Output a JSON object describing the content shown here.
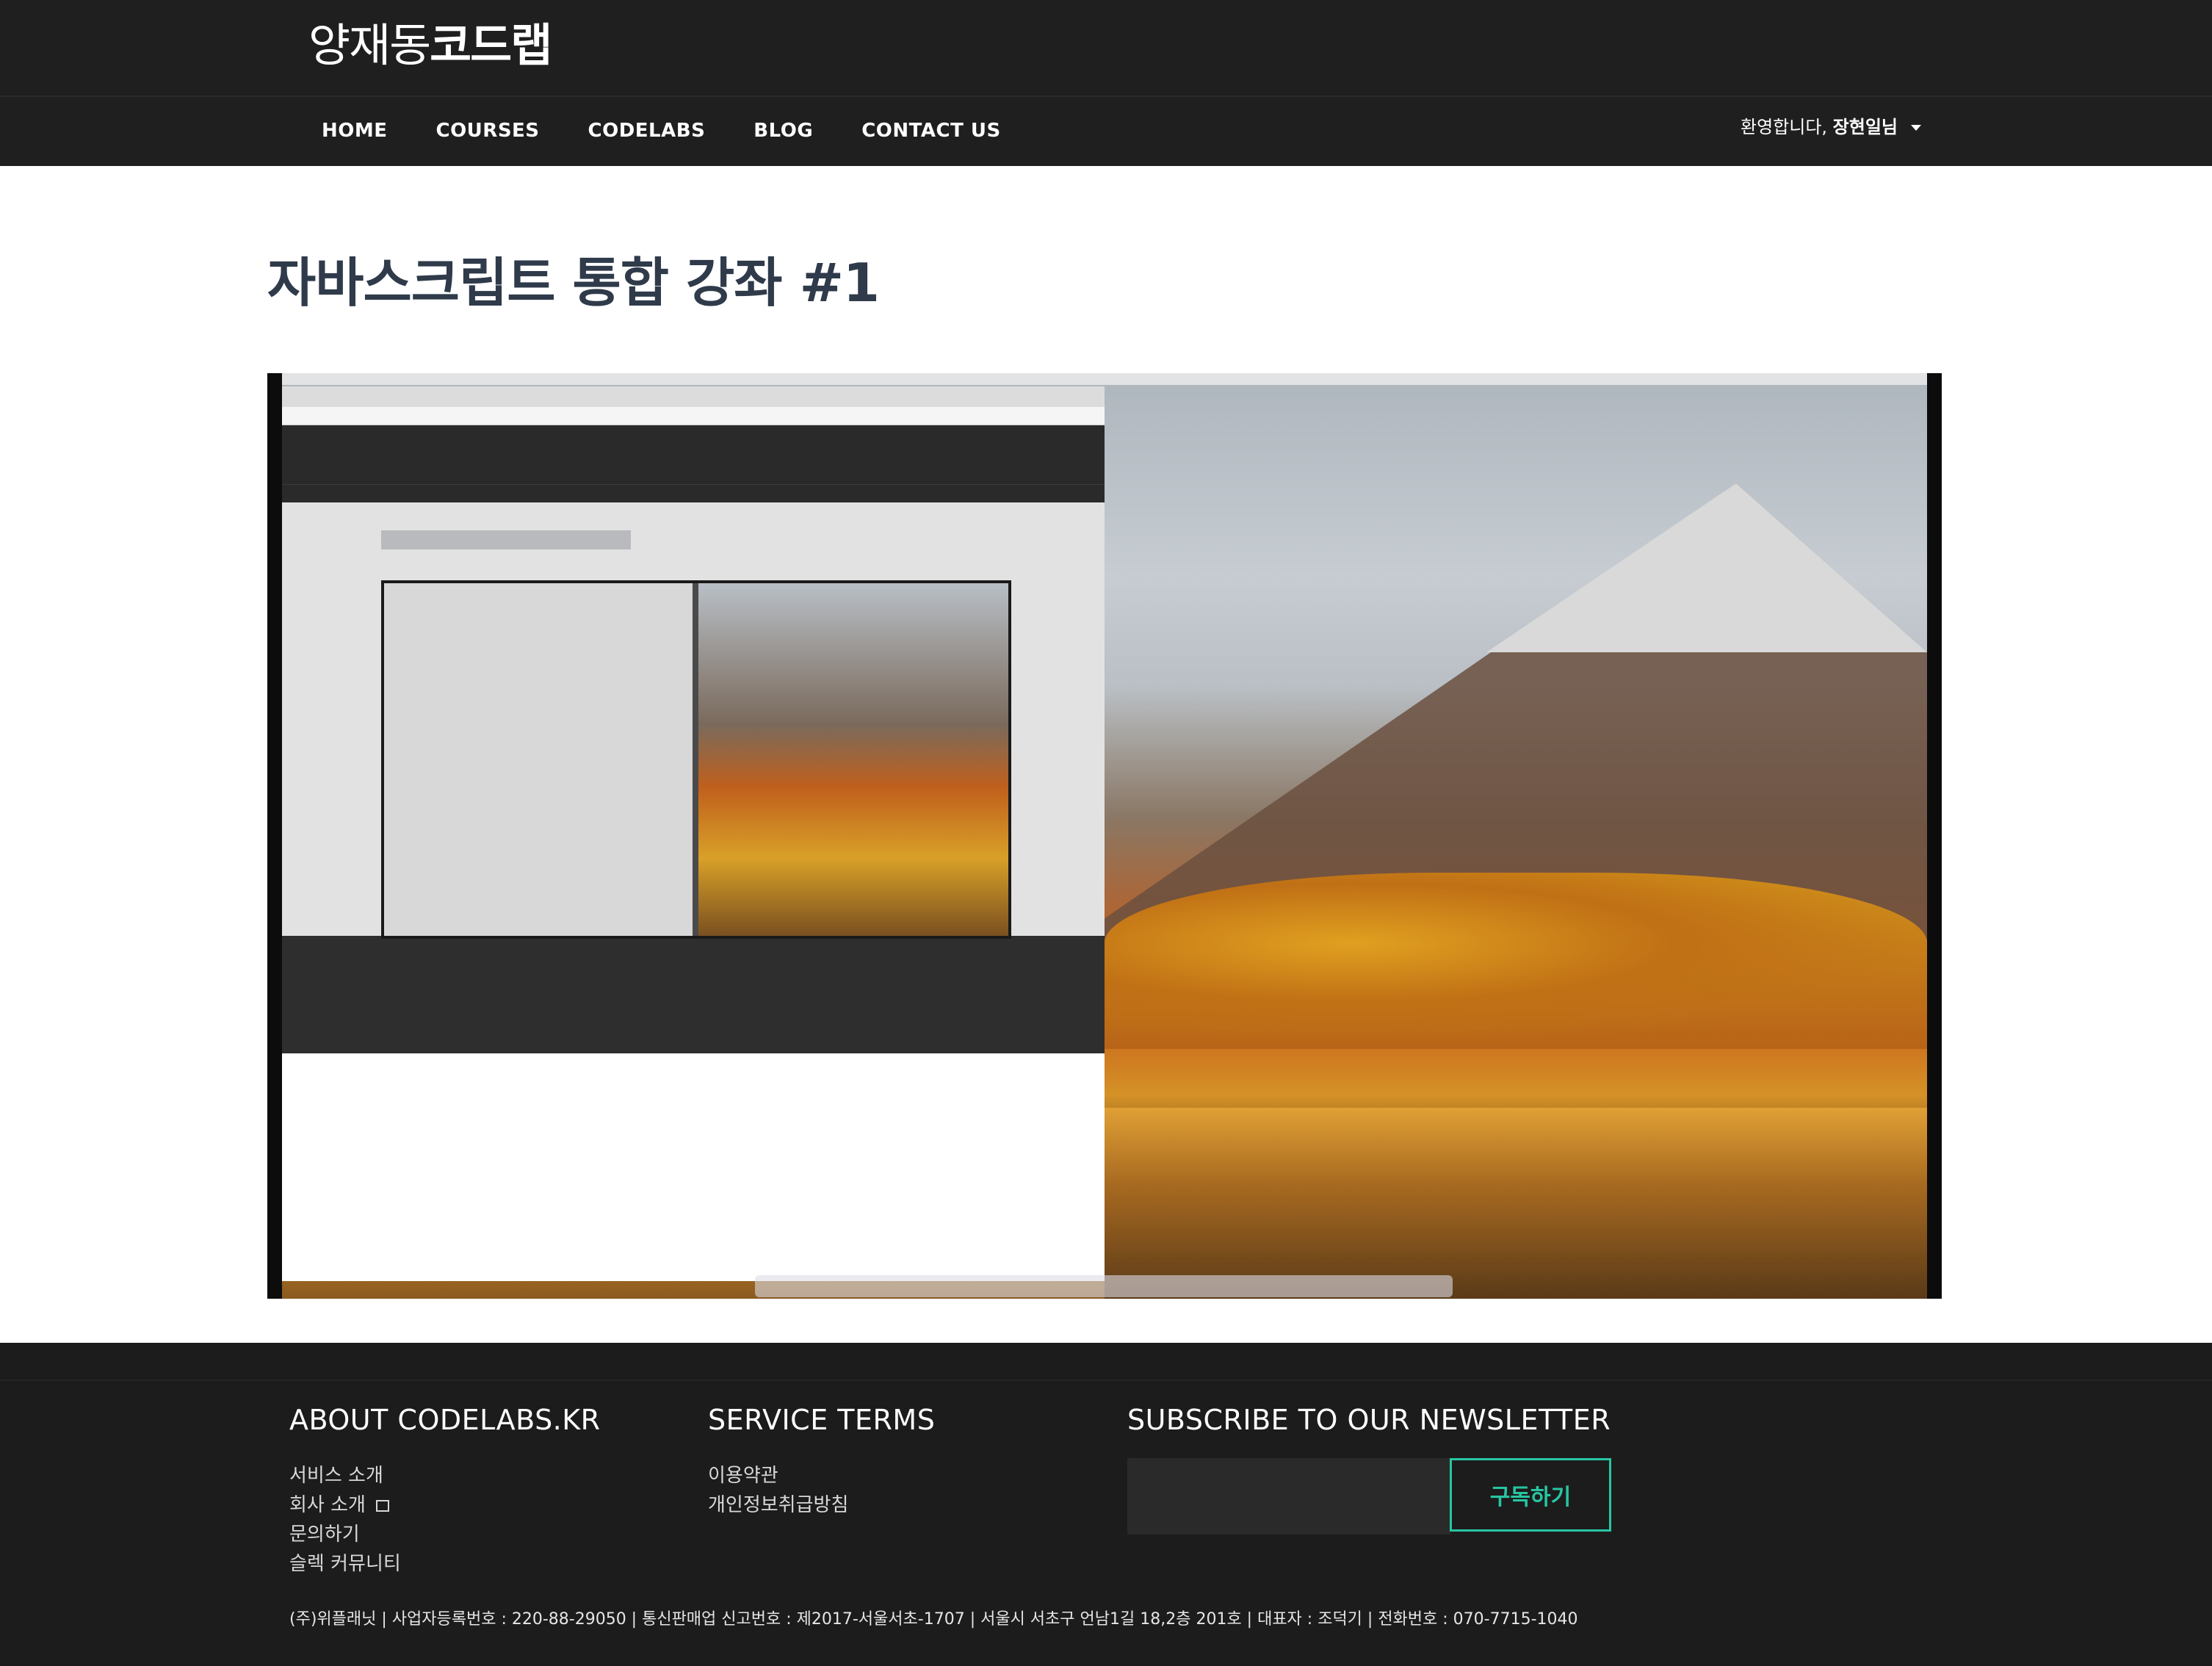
{
  "header": {
    "logo_light": "양재동",
    "logo_bold": "코드랩",
    "nav": [
      "HOME",
      "COURSES",
      "CODELABS",
      "BLOG",
      "CONTACT US"
    ],
    "welcome_prefix": "환영합니다, ",
    "welcome_user": "장현일님"
  },
  "main": {
    "title": "자바스크립트 통합 강좌 #1"
  },
  "footer": {
    "about": {
      "heading": "ABOUT CODELABS.KR",
      "items": [
        "서비스 소개",
        "회사 소개",
        "문의하기",
        "슬렉 커뮤니티"
      ]
    },
    "terms": {
      "heading": "SERVICE TERMS",
      "items": [
        "이용약관",
        "개인정보취급방침"
      ]
    },
    "newsletter": {
      "heading": "SUBSCRIBE TO OUR NEWSLETTER",
      "input_value": "",
      "button_label": "구독하기"
    },
    "company_info": "(주)위플래닛 | 사업자등록번호 : 220-88-29050 | 통신판매업 신고번호 : 제2017-서울서초-1707 | 서울시 서초구 언남1길 18,2층 201호 | 대표자 : 조덕기 | 전화번호 : 070-7715-1040"
  },
  "colors": {
    "header_bg": "#1f1f1f",
    "footer_bg": "#1c1c1c",
    "accent": "#27c5a2",
    "title": "#2f3a4a"
  }
}
